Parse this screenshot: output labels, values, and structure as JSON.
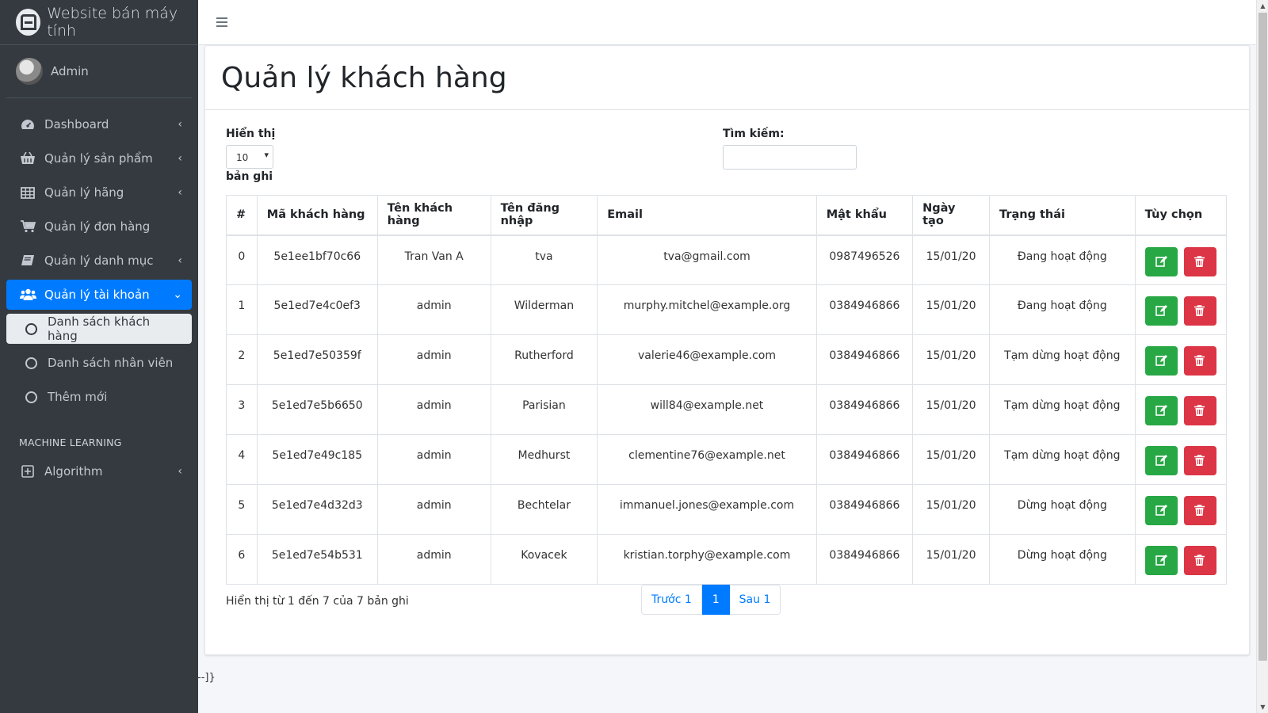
{
  "brand": {
    "title": "Website bán máy tính"
  },
  "user": {
    "name": "Admin"
  },
  "sidebar": {
    "items": [
      {
        "label": "Dashboard"
      },
      {
        "label": "Quản lý sản phẩm"
      },
      {
        "label": "Quản lý hãng"
      },
      {
        "label": "Quản lý đơn hàng"
      },
      {
        "label": "Quản lý danh mục"
      },
      {
        "label": "Quản lý tài khoản"
      }
    ],
    "subitems": [
      {
        "label": "Danh sách khách hàng"
      },
      {
        "label": "Danh sách nhân viên"
      },
      {
        "label": "Thêm mới"
      }
    ],
    "section_header": "MACHINE LEARNING",
    "ml_items": [
      {
        "label": "Algorithm"
      }
    ]
  },
  "page": {
    "title": "Quản lý khách hàng"
  },
  "controls": {
    "length_label": "Hiển thị",
    "length_value": "10",
    "length_suffix": "bản ghi",
    "search_label": "Tìm kiếm:"
  },
  "table": {
    "headers": [
      "#",
      "Mã khách hàng",
      "Tên khách hàng",
      "Tên đăng nhập",
      "Email",
      "Mật khẩu",
      "Ngày tạo",
      "Trạng thái",
      "Tùy chọn"
    ],
    "rows": [
      [
        "0",
        "5e1ee1bf70c66",
        "Tran Van A",
        "tva",
        "tva@gmail.com",
        "0987496526",
        "15/01/20",
        "Đang hoạt động"
      ],
      [
        "1",
        "5e1ed7e4c0ef3",
        "admin",
        "Wilderman",
        "murphy.mitchel@example.org",
        "0384946866",
        "15/01/20",
        "Đang hoạt động"
      ],
      [
        "2",
        "5e1ed7e50359f",
        "admin",
        "Rutherford",
        "valerie46@example.com",
        "0384946866",
        "15/01/20",
        "Tạm dừng hoạt động"
      ],
      [
        "3",
        "5e1ed7e5b6650",
        "admin",
        "Parisian",
        "will84@example.net",
        "0384946866",
        "15/01/20",
        "Tạm dừng hoạt động"
      ],
      [
        "4",
        "5e1ed7e49c185",
        "admin",
        "Medhurst",
        "clementine76@example.net",
        "0384946866",
        "15/01/20",
        "Tạm dừng hoạt động"
      ],
      [
        "5",
        "5e1ed7e4d32d3",
        "admin",
        "Bechtelar",
        "immanuel.jones@example.com",
        "0384946866",
        "15/01/20",
        "Dừng hoạt động"
      ],
      [
        "6",
        "5e1ed7e54b531",
        "admin",
        "Kovacek",
        "kristian.torphy@example.com",
        "0384946866",
        "15/01/20",
        "Dừng hoạt động"
      ]
    ]
  },
  "footer": {
    "info": "Hiển thị từ 1 đến 7 của 7 bản ghi",
    "prev": "Trước 1",
    "current": "1",
    "next": "Sau 1"
  },
  "stray_text": "--]}",
  "colors": {
    "primary": "#007bff",
    "success": "#28a745",
    "danger": "#dc3545",
    "sidebar": "#343a40"
  },
  "icons": [
    "menu-icon",
    "tachometer-icon",
    "basket-icon",
    "table-icon",
    "cart-icon",
    "book-icon",
    "users-icon",
    "circle-icon",
    "plus-square-icon",
    "chevron-left-icon",
    "chevron-down-icon",
    "edit-icon",
    "trash-icon"
  ]
}
